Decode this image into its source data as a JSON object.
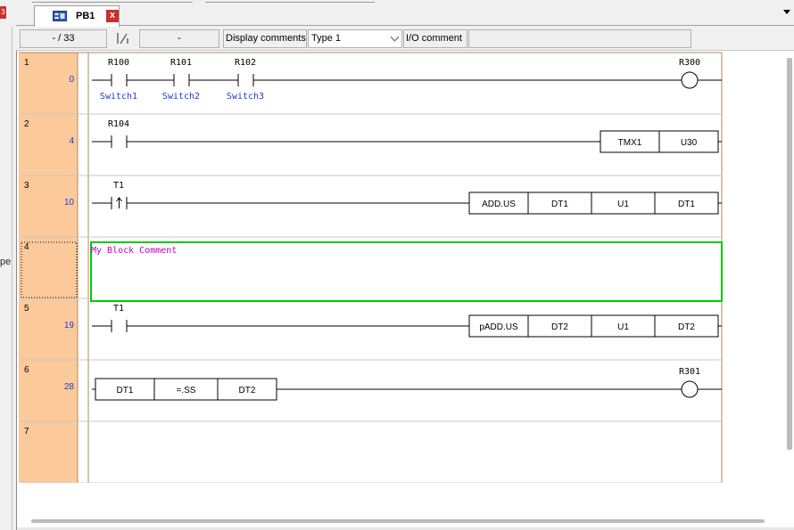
{
  "left_fragment": "pe",
  "left_badge": "3",
  "tab": {
    "label": "PB1",
    "close_symbol": "x",
    "icon": "program-block-icon"
  },
  "toolbar": {
    "address": "- /     33",
    "address_right": "-",
    "display_comments_label": "Display comments",
    "type_select_value": "Type 1",
    "io_comment_label": "I/O comment"
  },
  "colors": {
    "row_header_bg": "#fcc99a",
    "block_comment_border": "#00cc00",
    "block_comment_text": "#c000c0",
    "io_comment_text": "#1f3ccc",
    "address_text": "#1f3ccc"
  },
  "rungs": [
    {
      "number": "1",
      "address": "0",
      "contacts": [
        {
          "device": "R100",
          "comment": "Switch1",
          "type": "NO"
        },
        {
          "device": "R101",
          "comment": "Switch2",
          "type": "NO"
        },
        {
          "device": "R102",
          "comment": "Switch3",
          "type": "NO"
        }
      ],
      "coil": {
        "device": "R300"
      }
    },
    {
      "number": "2",
      "address": "4",
      "contacts": [
        {
          "device": "R104",
          "type": "NO"
        }
      ],
      "instruction": [
        "TMX1",
        "U30"
      ]
    },
    {
      "number": "3",
      "address": "10",
      "contacts": [
        {
          "device": "T1",
          "type": "rising-edge"
        }
      ],
      "instruction": [
        "ADD.US",
        "DT1",
        "U1",
        "DT1"
      ]
    },
    {
      "number": "4",
      "address": "",
      "block_comment": "My Block Comment"
    },
    {
      "number": "5",
      "address": "19",
      "contacts": [
        {
          "device": "T1",
          "type": "NO"
        }
      ],
      "instruction": [
        "pADD.US",
        "DT2",
        "U1",
        "DT2"
      ]
    },
    {
      "number": "6",
      "address": "28",
      "compare": [
        "DT1",
        "=.SS",
        "DT2"
      ],
      "coil": {
        "device": "R301"
      }
    },
    {
      "number": "7",
      "address": ""
    }
  ]
}
